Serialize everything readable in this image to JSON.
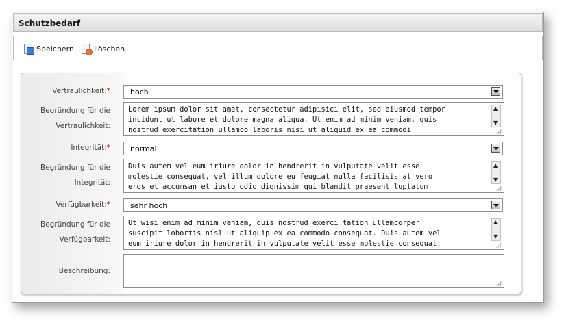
{
  "window": {
    "title": "Schutzbedarf"
  },
  "toolbar": {
    "save_label": "Speichern",
    "delete_label": "Löschen"
  },
  "form": {
    "confidentiality": {
      "label": "Vertraulichkeit:",
      "required_mark": "*",
      "value": "hoch"
    },
    "confidentiality_reason": {
      "label_line1": "Begründung für die",
      "label_line2": "Vertraulichkeit:",
      "lines": [
        "Lorem ipsum dolor sit amet, consectetur adipisici elit, sed eiusmod tempor",
        "incidunt ut labore et dolore magna aliqua. Ut enim ad minim veniam, quis",
        "nostrud exercitation ullamco laboris nisi ut aliquid ex ea commodi"
      ]
    },
    "integrity": {
      "label": "Integrität:",
      "required_mark": "*",
      "value": "normal"
    },
    "integrity_reason": {
      "label_line1": "Begründung für die",
      "label_line2": "Integrität:",
      "lines": [
        "Duis autem vel eum iriure dolor in hendrerit in vulputate velit esse",
        "molestie consequat, vel illum dolore eu feugiat nulla facilisis at vero",
        "eros et accumsan et iusto odio dignissim qui blandit praesent luptatum"
      ]
    },
    "availability": {
      "label": "Verfügbarkeit:",
      "required_mark": "*",
      "value": "sehr hoch"
    },
    "availability_reason": {
      "label_line1": "Begründung für die",
      "label_line2": "Verfügbarkeit:",
      "lines": [
        "Ut wisi enim ad minim veniam, quis nostrud exerci tation ullamcorper",
        "suscipit lobortis nisl ut aliquip ex ea commodo consequat. Duis autem vel",
        "eum iriure dolor in hendrerit in vulputate velit esse molestie consequat,"
      ]
    },
    "description": {
      "label": "Beschreibung:",
      "value": ""
    }
  },
  "icons": {
    "save": "save-document-icon",
    "delete": "delete-document-icon",
    "dropdown": "dropdown-arrow-icon",
    "scroll_up": "scroll-up-icon",
    "scroll_down": "scroll-down-icon",
    "resize": "resize-grip-icon"
  },
  "colors": {
    "required": "#c00000",
    "border": "#8e8e8e",
    "titlebar": "#e6e6e6"
  }
}
